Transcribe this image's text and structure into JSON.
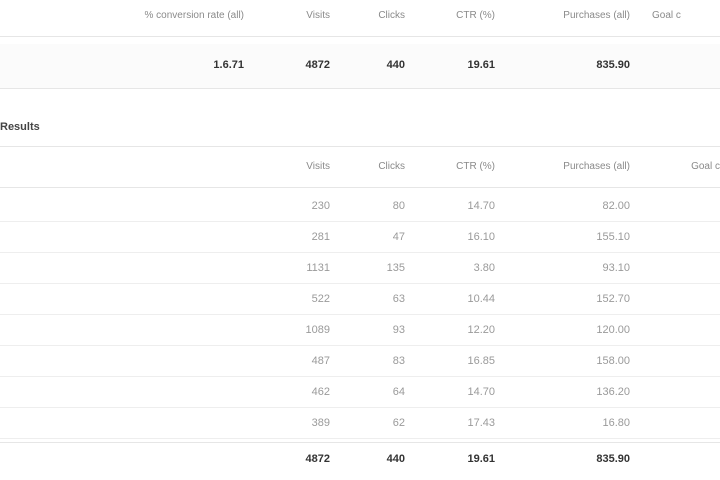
{
  "summary": {
    "headers": [
      "% conversion rate (all)",
      "Visits",
      "Clicks",
      "CTR (%)",
      "Purchases (all)",
      "Goal c"
    ],
    "values": [
      "1.6.71",
      "4872",
      "440",
      "19.61",
      "835.90"
    ]
  },
  "section": {
    "title": "Results",
    "headers": [
      "Visits",
      "Clicks",
      "CTR (%)",
      "Purchases (all)",
      "Goal c"
    ],
    "rows": [
      [
        "230",
        "80",
        "14.70",
        "82.00"
      ],
      [
        "281",
        "47",
        "16.10",
        "155.10"
      ],
      [
        "1131",
        "135",
        "3.80",
        "93.10"
      ],
      [
        "522",
        "63",
        "10.44",
        "152.70"
      ],
      [
        "1089",
        "93",
        "12.20",
        "120.00"
      ],
      [
        "487",
        "83",
        "16.85",
        "158.00"
      ],
      [
        "462",
        "64",
        "14.70",
        "136.20"
      ],
      [
        "389",
        "62",
        "17.43",
        "16.80"
      ]
    ],
    "total": [
      "4872",
      "440",
      "19.61",
      "835.90"
    ]
  }
}
